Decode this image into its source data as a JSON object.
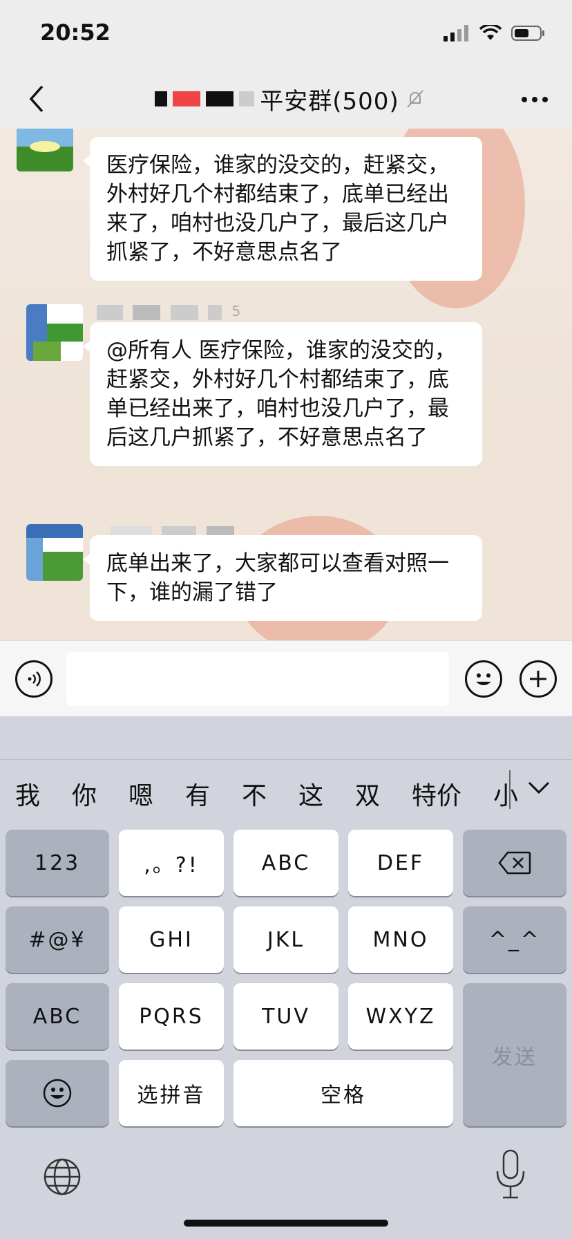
{
  "status_bar": {
    "time": "20:52"
  },
  "nav": {
    "title": "平安群(500)"
  },
  "messages": [
    {
      "text": "医疗保险，谁家的没交的，赶紧交，外村好几个村都结束了，底单已经出来了，咱村也没几户了，最后这几户抓紧了，不好意思点名了"
    },
    {
      "sender": "5",
      "text": "@所有人 医疗保险，谁家的没交的，赶紧交，外村好几个村都结束了，底单已经出来了，咱村也没几户了，最后这几户抓紧了，不好意思点名了"
    },
    {
      "text": "底单出来了，大家都可以查看对照一下，谁的漏了错了"
    }
  ],
  "input": {
    "value": "",
    "placeholder": ""
  },
  "keyboard": {
    "candidates": [
      "我",
      "你",
      "嗯",
      "有",
      "不",
      "这",
      "双",
      "特价",
      "小"
    ],
    "keys": {
      "num": "123",
      "punct": ",。?!",
      "abc": "ABC",
      "def": "DEF",
      "sym": "#@¥",
      "ghi": "GHI",
      "jkl": "JKL",
      "mno": "MNO",
      "kaomoji": "^_^",
      "abc_switch": "ABC",
      "pqrs": "PQRS",
      "tuv": "TUV",
      "wxyz": "WXYZ",
      "send": "发送",
      "pinyin": "选拼音",
      "space": "空格"
    }
  },
  "colors": {
    "bubble": "#ffffff",
    "keyboard_bg": "#d1d4dc",
    "dark_key": "#abb1bd"
  }
}
